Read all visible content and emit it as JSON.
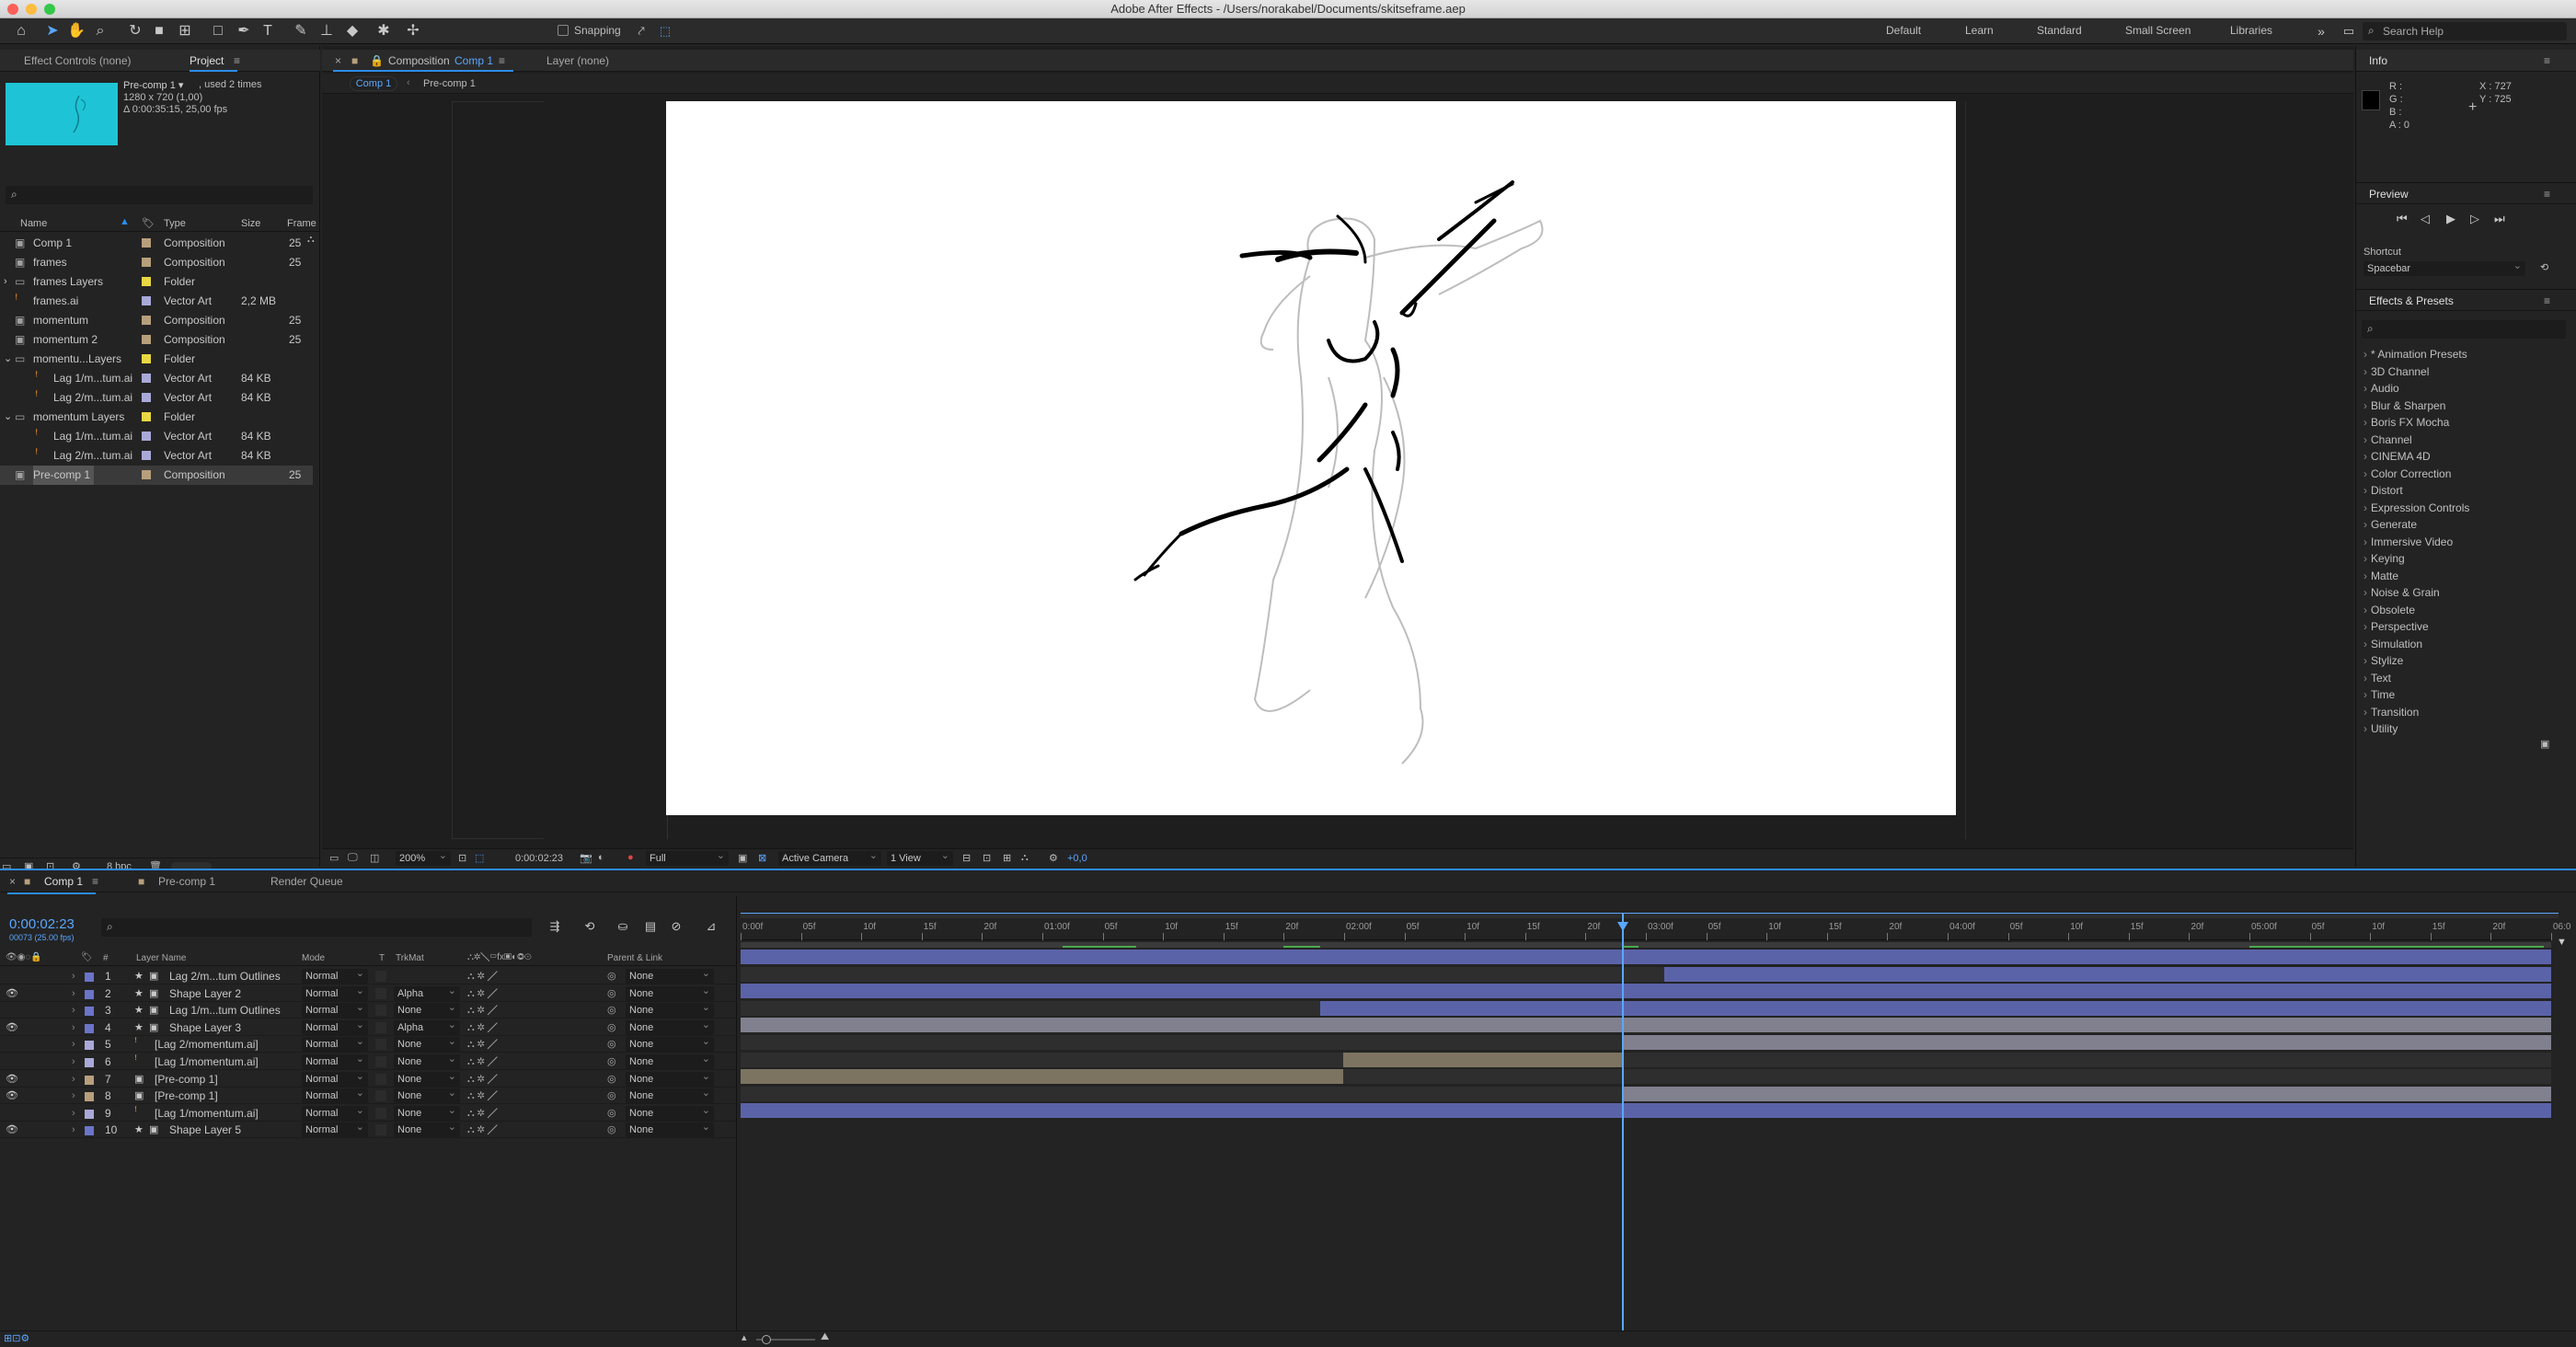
{
  "window": {
    "title": "Adobe After Effects - /Users/norakabel/Documents/skitseframe.aep"
  },
  "toolbar": {
    "snapping_label": "Snapping",
    "workspaces": [
      "Default",
      "Learn",
      "Standard",
      "Small Screen",
      "Libraries"
    ],
    "search_placeholder": "Search Help"
  },
  "project": {
    "tab_effect_controls": "Effect Controls (none)",
    "tab_project": "Project",
    "selected_name": "Pre-comp 1 ▾",
    "selected_used": ", used 2 times",
    "selected_dims": "1280 x 720 (1,00)",
    "selected_dur": "Δ 0:00:35:15, 25,00 fps",
    "search_placeholder": "",
    "columns": {
      "name": "Name",
      "type": "Type",
      "size": "Size",
      "frame": "Frame"
    },
    "items": [
      {
        "name": "Comp 1",
        "type": "Composition",
        "size": "",
        "frame": "25",
        "color": "#b89f7c",
        "indent": 0,
        "twirl": "",
        "icon": "comp"
      },
      {
        "name": "frames",
        "type": "Composition",
        "size": "",
        "frame": "25",
        "color": "#b89f7c",
        "indent": 0,
        "twirl": "",
        "icon": "comp"
      },
      {
        "name": "frames Layers",
        "type": "Folder",
        "size": "",
        "frame": "",
        "color": "#e8d742",
        "indent": 0,
        "twirl": "›",
        "icon": "folder"
      },
      {
        "name": "frames.ai",
        "type": "Vector Art",
        "size": "2,2 MB",
        "frame": "",
        "color": "#a9a9d9",
        "indent": 0,
        "twirl": "",
        "icon": "ai"
      },
      {
        "name": "momentum",
        "type": "Composition",
        "size": "",
        "frame": "25",
        "color": "#b89f7c",
        "indent": 0,
        "twirl": "",
        "icon": "comp"
      },
      {
        "name": "momentum 2",
        "type": "Composition",
        "size": "",
        "frame": "25",
        "color": "#b89f7c",
        "indent": 0,
        "twirl": "",
        "icon": "comp"
      },
      {
        "name": "momentu...Layers",
        "type": "Folder",
        "size": "",
        "frame": "",
        "color": "#e8d742",
        "indent": 0,
        "twirl": "⌄",
        "icon": "folder"
      },
      {
        "name": "Lag 1/m...tum.ai",
        "type": "Vector Art",
        "size": "84 KB",
        "frame": "",
        "color": "#a9a9d9",
        "indent": 1,
        "twirl": "",
        "icon": "ai"
      },
      {
        "name": "Lag 2/m...tum.ai",
        "type": "Vector Art",
        "size": "84 KB",
        "frame": "",
        "color": "#a9a9d9",
        "indent": 1,
        "twirl": "",
        "icon": "ai"
      },
      {
        "name": "momentum Layers",
        "type": "Folder",
        "size": "",
        "frame": "",
        "color": "#e8d742",
        "indent": 0,
        "twirl": "⌄",
        "icon": "folder"
      },
      {
        "name": "Lag 1/m...tum.ai",
        "type": "Vector Art",
        "size": "84 KB",
        "frame": "",
        "color": "#a9a9d9",
        "indent": 1,
        "twirl": "",
        "icon": "ai"
      },
      {
        "name": "Lag 2/m...tum.ai",
        "type": "Vector Art",
        "size": "84 KB",
        "frame": "",
        "color": "#a9a9d9",
        "indent": 1,
        "twirl": "",
        "icon": "ai"
      },
      {
        "name": "Pre-comp 1",
        "type": "Composition",
        "size": "",
        "frame": "25",
        "color": "#b89f7c",
        "indent": 0,
        "twirl": "",
        "icon": "comp",
        "selected": true
      }
    ],
    "bpc": "8 bpc"
  },
  "composition": {
    "panel_label": "Composition",
    "comp_name": "Comp 1",
    "layer_tab": "Layer (none)",
    "breadcrumbs": [
      "Comp 1",
      "Pre-comp 1"
    ],
    "zoom": "200%",
    "timecode": "0:00:02:23",
    "resolution": "Full",
    "camera": "Active Camera",
    "view": "1 View",
    "exposure": "+0,0"
  },
  "info": {
    "title": "Info",
    "r": "R :",
    "g": "G :",
    "b": "B :",
    "a": "A : 0",
    "x": "X : 727",
    "y": "Y : 725"
  },
  "preview": {
    "title": "Preview",
    "shortcut_label": "Shortcut",
    "shortcut_value": "Spacebar"
  },
  "effects": {
    "title": "Effects & Presets",
    "items": [
      "* Animation Presets",
      "3D Channel",
      "Audio",
      "Blur & Sharpen",
      "Boris FX Mocha",
      "Channel",
      "CINEMA 4D",
      "Color Correction",
      "Distort",
      "Expression Controls",
      "Generate",
      "Immersive Video",
      "Keying",
      "Matte",
      "Noise & Grain",
      "Obsolete",
      "Perspective",
      "Simulation",
      "Stylize",
      "Text",
      "Time",
      "Transition",
      "Utility"
    ]
  },
  "timeline": {
    "tabs": [
      "Comp 1",
      "Pre-comp 1",
      "Render Queue"
    ],
    "timecode": "0:00:02:23",
    "frames_info": "00073 (25.00 fps)",
    "columns": {
      "num": "#",
      "layer_name": "Layer Name",
      "mode": "Mode",
      "t": "T",
      "trkmat": "TrkMat",
      "parent": "Parent & Link"
    },
    "ruler": [
      "0:00f",
      "05f",
      "10f",
      "15f",
      "20f",
      "01:00f",
      "05f",
      "10f",
      "15f",
      "20f",
      "02:00f",
      "05f",
      "10f",
      "15f",
      "20f",
      "03:00f",
      "05f",
      "10f",
      "15f",
      "20f",
      "04:00f",
      "05f",
      "10f",
      "15f",
      "20f",
      "05:00f",
      "05f",
      "10f",
      "15f",
      "20f",
      "06:0"
    ],
    "layers": [
      {
        "num": "1",
        "name": "Lag 2/m...tum Outlines",
        "mode": "Normal",
        "trkmat": "",
        "parent": "None",
        "color": "#6b74c9",
        "eye": false,
        "icon": "star",
        "bar": "#5b63a8",
        "barStart": 0,
        "barEnd": 1,
        "dark": 0
      },
      {
        "num": "2",
        "name": "Shape Layer 2",
        "mode": "Normal",
        "trkmat": "Alpha",
        "parent": "None",
        "color": "#6b74c9",
        "eye": true,
        "icon": "star",
        "bar": "#5b63a8",
        "barStart": 0.51,
        "barEnd": 1,
        "dark": 0
      },
      {
        "num": "3",
        "name": "Lag 1/m...tum Outlines",
        "mode": "Normal",
        "trkmat": "None",
        "parent": "None",
        "color": "#6b74c9",
        "eye": false,
        "icon": "star",
        "bar": "#5b63a8",
        "barStart": 0,
        "barEnd": 1,
        "dark": 0
      },
      {
        "num": "4",
        "name": "Shape Layer 3",
        "mode": "Normal",
        "trkmat": "Alpha",
        "parent": "None",
        "color": "#6b74c9",
        "eye": true,
        "icon": "star",
        "bar": "#5b63a8",
        "barStart": 0.32,
        "barEnd": 1,
        "dark": 0
      },
      {
        "num": "5",
        "name": "[Lag 2/momentum.ai]",
        "mode": "Normal",
        "trkmat": "None",
        "parent": "None",
        "color": "#a9a9d9",
        "eye": false,
        "icon": "ai",
        "bar": "#80808f",
        "barStart": 0,
        "barEnd": 1,
        "dark": 0
      },
      {
        "num": "6",
        "name": "[Lag 1/momentum.ai]",
        "mode": "Normal",
        "trkmat": "None",
        "parent": "None",
        "color": "#a9a9d9",
        "eye": false,
        "icon": "ai",
        "bar": "#80808f",
        "barStart": 0.487,
        "barEnd": 1,
        "dark": 0
      },
      {
        "num": "7",
        "name": "[Pre-comp 1]",
        "mode": "Normal",
        "trkmat": "None",
        "parent": "None",
        "color": "#b89f7c",
        "eye": true,
        "icon": "comp",
        "bar": "#7c7361",
        "barStart": 0.333,
        "barEnd": 0.487,
        "dark": 0
      },
      {
        "num": "8",
        "name": "[Pre-comp 1]",
        "mode": "Normal",
        "trkmat": "None",
        "parent": "None",
        "color": "#b89f7c",
        "eye": true,
        "icon": "comp",
        "bar": "#7c7361",
        "barStart": 0,
        "barEnd": 0.333,
        "dark": 0
      },
      {
        "num": "9",
        "name": "[Lag 1/momentum.ai]",
        "mode": "Normal",
        "trkmat": "None",
        "parent": "None",
        "color": "#a9a9d9",
        "eye": false,
        "icon": "ai",
        "bar": "#80808f",
        "barStart": 0.487,
        "barEnd": 1,
        "dark": 0
      },
      {
        "num": "10",
        "name": "Shape Layer 5",
        "mode": "Normal",
        "trkmat": "None",
        "parent": "None",
        "color": "#6b74c9",
        "eye": true,
        "icon": "star",
        "bar": "#5b63a8",
        "barStart": 0,
        "barEnd": 1,
        "dark": 0
      }
    ],
    "playhead": 0.487
  },
  "colors": {
    "accent": "#2d8ceb",
    "panel": "#232323",
    "header": "#2a2a2a",
    "comp_bg": "#ffffff",
    "thumb": "#1ec4d6"
  }
}
